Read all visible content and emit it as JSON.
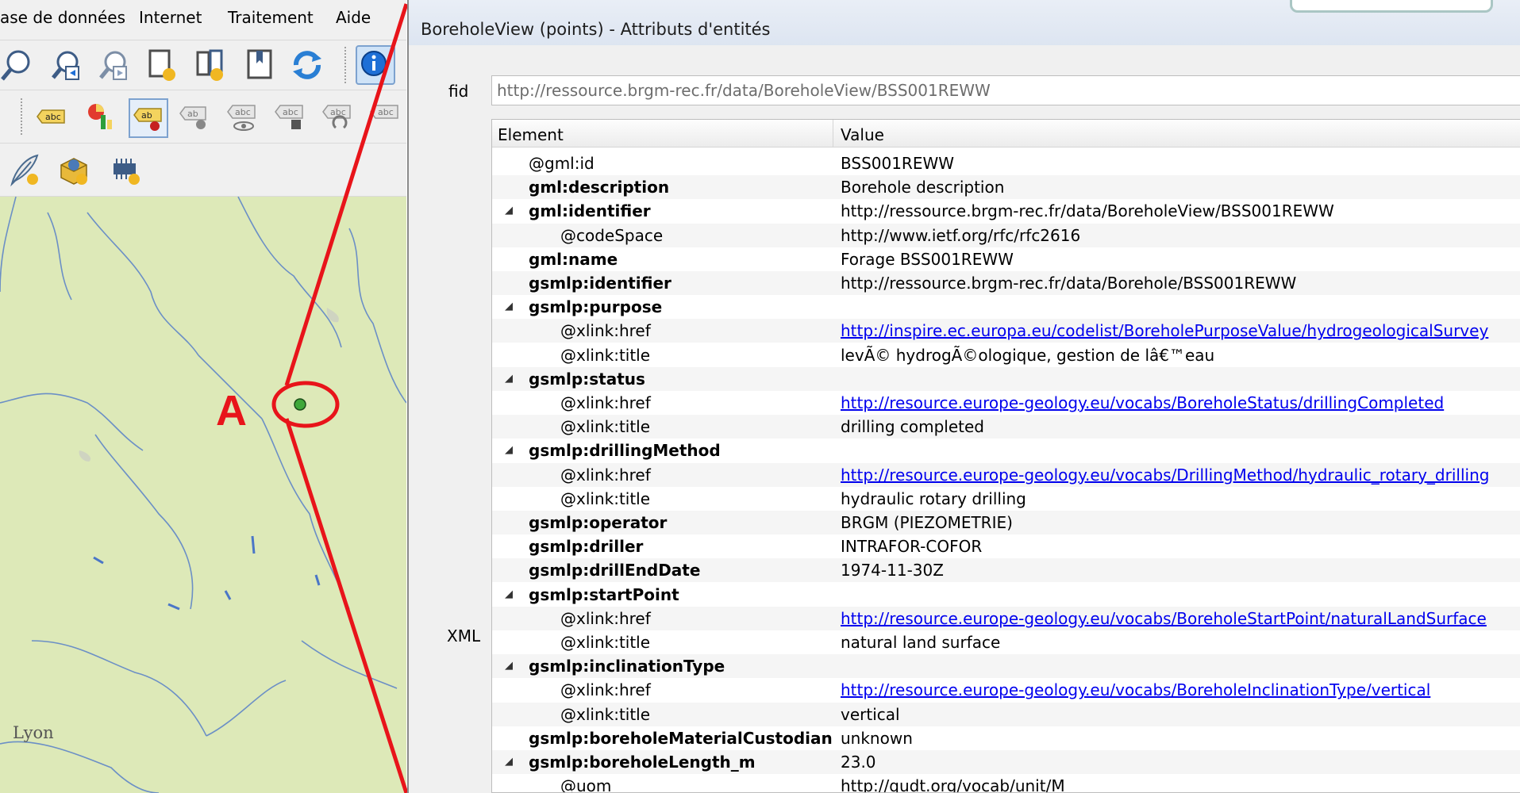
{
  "qgis": {
    "menu": [
      {
        "label": "ase de données",
        "name": "menu-base-de-donnees"
      },
      {
        "label": "Internet",
        "name": "menu-internet"
      },
      {
        "label": "Traitement",
        "name": "menu-traitement"
      },
      {
        "label": "Aide",
        "name": "menu-aide"
      }
    ],
    "map": {
      "city_label": "Lyon",
      "callout_label": "A",
      "background_color": "#dde9b8",
      "river_color": "#5b8ed1",
      "highlight_color": "#e8141a",
      "feature_point_color": "#3fa83a"
    },
    "toolbar_icons": {
      "row1": [
        "zoom-in-icon",
        "zoom-last-icon",
        "zoom-next-icon",
        "new-map-tile-icon",
        "map-tile-star-icon",
        "bookmark-icon",
        "refresh-icon",
        "identify-icon"
      ],
      "row2": [
        "label-abc-icon",
        "diagram-icon",
        "label-pin-icon",
        "label-show-icon",
        "label-visibility-icon",
        "label-move-icon",
        "label-rotate-icon",
        "label-change-icon"
      ],
      "row3": [
        "digitize-feather-icon",
        "new-geopackage-icon",
        "new-memory-layer-icon"
      ]
    }
  },
  "dialog": {
    "title": "BoreholeView (points) - Attributs d'entités",
    "fid_label": "fid",
    "fid_value": "http://ressource.brgm-rec.fr/data/BoreholeView/BSS001REWW",
    "xml_label": "XML",
    "columns": {
      "element": "Element",
      "value": "Value"
    },
    "rows": [
      {
        "element": "@gml:id",
        "value": "BSS001REWW",
        "level": 1,
        "bold": false,
        "expand": false,
        "link": false
      },
      {
        "element": "gml:description",
        "value": "Borehole description",
        "level": 1,
        "bold": true,
        "expand": false,
        "link": false
      },
      {
        "element": "gml:identifier",
        "value": "http://ressource.brgm-rec.fr/data/BoreholeView/BSS001REWW",
        "level": 1,
        "bold": true,
        "expand": true,
        "link": false
      },
      {
        "element": "@codeSpace",
        "value": "http://www.ietf.org/rfc/rfc2616",
        "level": 2,
        "bold": false,
        "expand": false,
        "link": false
      },
      {
        "element": "gml:name",
        "value": "Forage BSS001REWW",
        "level": 1,
        "bold": true,
        "expand": false,
        "link": false
      },
      {
        "element": "gsmlp:identifier",
        "value": "http://ressource.brgm-rec.fr/data/Borehole/BSS001REWW",
        "level": 1,
        "bold": true,
        "expand": false,
        "link": false
      },
      {
        "element": "gsmlp:purpose",
        "value": "",
        "level": 1,
        "bold": true,
        "expand": true,
        "link": false
      },
      {
        "element": "@xlink:href",
        "value": "http://inspire.ec.europa.eu/codelist/BoreholePurposeValue/hydrogeologicalSurvey",
        "level": 2,
        "bold": false,
        "expand": false,
        "link": true
      },
      {
        "element": "@xlink:title",
        "value": "levÃ© hydrogÃ©ologique, gestion de lâ€™eau",
        "level": 2,
        "bold": false,
        "expand": false,
        "link": false
      },
      {
        "element": "gsmlp:status",
        "value": "",
        "level": 1,
        "bold": true,
        "expand": true,
        "link": false
      },
      {
        "element": "@xlink:href",
        "value": "http://resource.europe-geology.eu/vocabs/BoreholeStatus/drillingCompleted",
        "level": 2,
        "bold": false,
        "expand": false,
        "link": true
      },
      {
        "element": "@xlink:title",
        "value": "drilling completed",
        "level": 2,
        "bold": false,
        "expand": false,
        "link": false
      },
      {
        "element": "gsmlp:drillingMethod",
        "value": "",
        "level": 1,
        "bold": true,
        "expand": true,
        "link": false
      },
      {
        "element": "@xlink:href",
        "value": "http://resource.europe-geology.eu/vocabs/DrillingMethod/hydraulic_rotary_drilling",
        "level": 2,
        "bold": false,
        "expand": false,
        "link": true
      },
      {
        "element": "@xlink:title",
        "value": "hydraulic rotary drilling",
        "level": 2,
        "bold": false,
        "expand": false,
        "link": false
      },
      {
        "element": "gsmlp:operator",
        "value": "BRGM (PIEZOMETRIE)",
        "level": 1,
        "bold": true,
        "expand": false,
        "link": false
      },
      {
        "element": "gsmlp:driller",
        "value": "INTRAFOR-COFOR",
        "level": 1,
        "bold": true,
        "expand": false,
        "link": false
      },
      {
        "element": "gsmlp:drillEndDate",
        "value": "1974-11-30Z",
        "level": 1,
        "bold": true,
        "expand": false,
        "link": false
      },
      {
        "element": "gsmlp:startPoint",
        "value": "",
        "level": 1,
        "bold": true,
        "expand": true,
        "link": false
      },
      {
        "element": "@xlink:href",
        "value": "http://resource.europe-geology.eu/vocabs/BoreholeStartPoint/naturalLandSurface",
        "level": 2,
        "bold": false,
        "expand": false,
        "link": true
      },
      {
        "element": "@xlink:title",
        "value": "natural land surface",
        "level": 2,
        "bold": false,
        "expand": false,
        "link": false
      },
      {
        "element": "gsmlp:inclinationType",
        "value": "",
        "level": 1,
        "bold": true,
        "expand": true,
        "link": false
      },
      {
        "element": "@xlink:href",
        "value": "http://resource.europe-geology.eu/vocabs/BoreholeInclinationType/vertical",
        "level": 2,
        "bold": false,
        "expand": false,
        "link": true
      },
      {
        "element": "@xlink:title",
        "value": "vertical",
        "level": 2,
        "bold": false,
        "expand": false,
        "link": false
      },
      {
        "element": "gsmlp:boreholeMaterialCustodian",
        "value": "unknown",
        "level": 1,
        "bold": true,
        "expand": false,
        "link": false
      },
      {
        "element": "gsmlp:boreholeLength_m",
        "value": "23.0",
        "level": 1,
        "bold": true,
        "expand": true,
        "link": false
      },
      {
        "element": "@uom",
        "value": "http://qudt.org/vocab/unit/M",
        "level": 2,
        "bold": false,
        "expand": false,
        "link": false
      }
    ]
  }
}
